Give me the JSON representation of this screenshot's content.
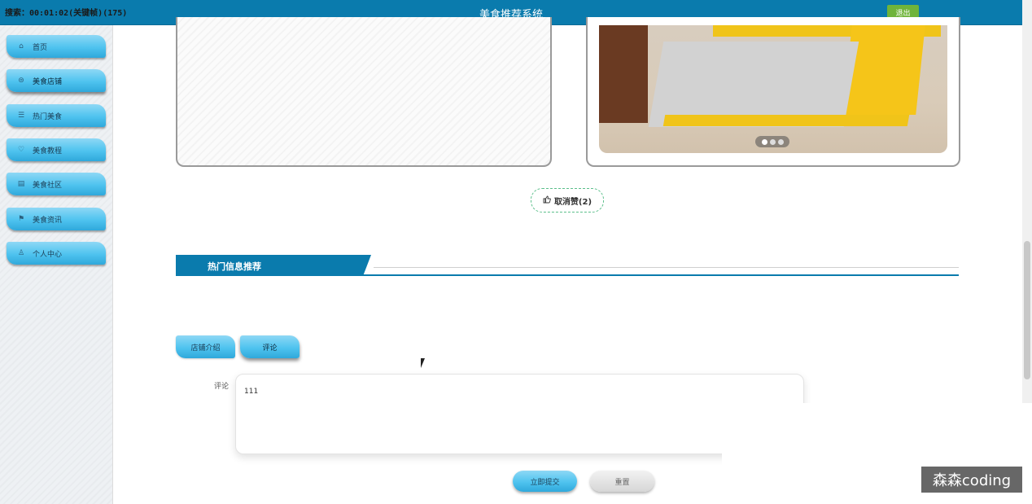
{
  "header": {
    "recording_status": "搜索：00:01:02(关键帧)(175)",
    "title": "美食推荐系统",
    "logout_label": "退出"
  },
  "sidebar": {
    "items": [
      {
        "label": "首页",
        "icon": "home-icon",
        "glyph": "⌂"
      },
      {
        "label": "美食店铺",
        "icon": "store-icon",
        "glyph": "⊜",
        "active": true
      },
      {
        "label": "热门美食",
        "icon": "sliders-icon",
        "glyph": "☰"
      },
      {
        "label": "美食教程",
        "icon": "bulb-icon",
        "glyph": "♡"
      },
      {
        "label": "美食社区",
        "icon": "community-icon",
        "glyph": "▤"
      },
      {
        "label": "美食资讯",
        "icon": "flag-icon",
        "glyph": "⚑"
      },
      {
        "label": "个人中心",
        "icon": "user-icon",
        "glyph": "♙"
      }
    ]
  },
  "carousel": {
    "dot_count": 3,
    "active_dot": 0
  },
  "like_button": {
    "label": "取消赞(2)",
    "icon": "thumbs-up-icon"
  },
  "section": {
    "title": "热门信息推荐"
  },
  "tabs": [
    {
      "label": "店铺介绍"
    },
    {
      "label": "评论",
      "active": true
    }
  ],
  "comment_form": {
    "field_label": "评论",
    "value": "111",
    "submit_label": "立即提交",
    "reset_label": "重置"
  },
  "watermark": "森森coding",
  "colors": {
    "header_bg": "#0a7bad",
    "accent_blue": "#4ec3ef",
    "logout_green": "#6fb43a",
    "like_border": "#5bbf8a"
  }
}
